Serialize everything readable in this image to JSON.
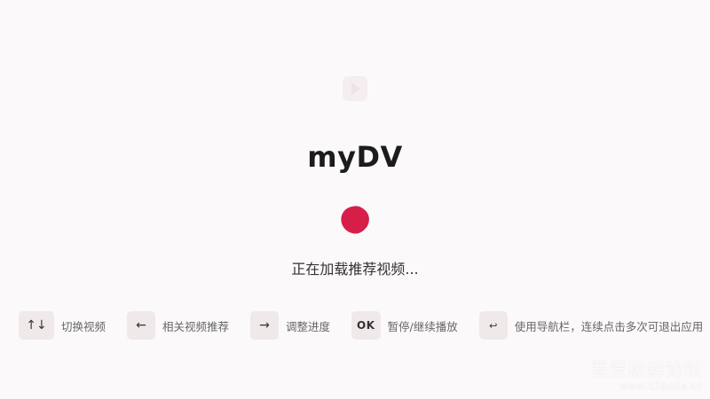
{
  "app": {
    "title": "myDV",
    "loading_text": "正在加载推荐视频..."
  },
  "icons": {
    "top_logo": "app-logo-icon",
    "loader": "loading-blob-icon"
  },
  "colors": {
    "background": "#fcf9fb",
    "accent": "#d61f48",
    "key_bg": "#efe9ea"
  },
  "hints": [
    {
      "key": "↑↓",
      "label": "切换视频"
    },
    {
      "key": "←",
      "label": "相关视频推荐"
    },
    {
      "key": "→",
      "label": "调整进度"
    },
    {
      "key": "OK",
      "label": "暂停/继续播放"
    },
    {
      "key": "↩",
      "label": "使用导航栏，连续点击多次可退出应用"
    }
  ],
  "watermark": {
    "main": "吾爱破解论坛",
    "sub": "www.52pojie.cn"
  }
}
